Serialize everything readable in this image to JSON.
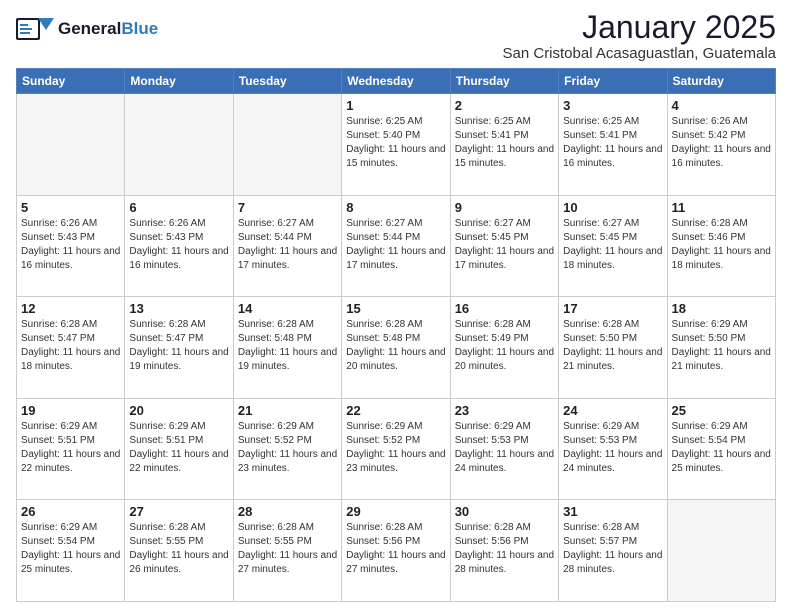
{
  "header": {
    "logo_general": "General",
    "logo_blue": "Blue",
    "month_title": "January 2025",
    "subtitle": "San Cristobal Acasaguastlan, Guatemala"
  },
  "days_of_week": [
    "Sunday",
    "Monday",
    "Tuesday",
    "Wednesday",
    "Thursday",
    "Friday",
    "Saturday"
  ],
  "weeks": [
    [
      {
        "num": "",
        "info": ""
      },
      {
        "num": "",
        "info": ""
      },
      {
        "num": "",
        "info": ""
      },
      {
        "num": "1",
        "info": "Sunrise: 6:25 AM\nSunset: 5:40 PM\nDaylight: 11 hours and 15 minutes."
      },
      {
        "num": "2",
        "info": "Sunrise: 6:25 AM\nSunset: 5:41 PM\nDaylight: 11 hours and 15 minutes."
      },
      {
        "num": "3",
        "info": "Sunrise: 6:25 AM\nSunset: 5:41 PM\nDaylight: 11 hours and 16 minutes."
      },
      {
        "num": "4",
        "info": "Sunrise: 6:26 AM\nSunset: 5:42 PM\nDaylight: 11 hours and 16 minutes."
      }
    ],
    [
      {
        "num": "5",
        "info": "Sunrise: 6:26 AM\nSunset: 5:43 PM\nDaylight: 11 hours and 16 minutes."
      },
      {
        "num": "6",
        "info": "Sunrise: 6:26 AM\nSunset: 5:43 PM\nDaylight: 11 hours and 16 minutes."
      },
      {
        "num": "7",
        "info": "Sunrise: 6:27 AM\nSunset: 5:44 PM\nDaylight: 11 hours and 17 minutes."
      },
      {
        "num": "8",
        "info": "Sunrise: 6:27 AM\nSunset: 5:44 PM\nDaylight: 11 hours and 17 minutes."
      },
      {
        "num": "9",
        "info": "Sunrise: 6:27 AM\nSunset: 5:45 PM\nDaylight: 11 hours and 17 minutes."
      },
      {
        "num": "10",
        "info": "Sunrise: 6:27 AM\nSunset: 5:45 PM\nDaylight: 11 hours and 18 minutes."
      },
      {
        "num": "11",
        "info": "Sunrise: 6:28 AM\nSunset: 5:46 PM\nDaylight: 11 hours and 18 minutes."
      }
    ],
    [
      {
        "num": "12",
        "info": "Sunrise: 6:28 AM\nSunset: 5:47 PM\nDaylight: 11 hours and 18 minutes."
      },
      {
        "num": "13",
        "info": "Sunrise: 6:28 AM\nSunset: 5:47 PM\nDaylight: 11 hours and 19 minutes."
      },
      {
        "num": "14",
        "info": "Sunrise: 6:28 AM\nSunset: 5:48 PM\nDaylight: 11 hours and 19 minutes."
      },
      {
        "num": "15",
        "info": "Sunrise: 6:28 AM\nSunset: 5:48 PM\nDaylight: 11 hours and 20 minutes."
      },
      {
        "num": "16",
        "info": "Sunrise: 6:28 AM\nSunset: 5:49 PM\nDaylight: 11 hours and 20 minutes."
      },
      {
        "num": "17",
        "info": "Sunrise: 6:28 AM\nSunset: 5:50 PM\nDaylight: 11 hours and 21 minutes."
      },
      {
        "num": "18",
        "info": "Sunrise: 6:29 AM\nSunset: 5:50 PM\nDaylight: 11 hours and 21 minutes."
      }
    ],
    [
      {
        "num": "19",
        "info": "Sunrise: 6:29 AM\nSunset: 5:51 PM\nDaylight: 11 hours and 22 minutes."
      },
      {
        "num": "20",
        "info": "Sunrise: 6:29 AM\nSunset: 5:51 PM\nDaylight: 11 hours and 22 minutes."
      },
      {
        "num": "21",
        "info": "Sunrise: 6:29 AM\nSunset: 5:52 PM\nDaylight: 11 hours and 23 minutes."
      },
      {
        "num": "22",
        "info": "Sunrise: 6:29 AM\nSunset: 5:52 PM\nDaylight: 11 hours and 23 minutes."
      },
      {
        "num": "23",
        "info": "Sunrise: 6:29 AM\nSunset: 5:53 PM\nDaylight: 11 hours and 24 minutes."
      },
      {
        "num": "24",
        "info": "Sunrise: 6:29 AM\nSunset: 5:53 PM\nDaylight: 11 hours and 24 minutes."
      },
      {
        "num": "25",
        "info": "Sunrise: 6:29 AM\nSunset: 5:54 PM\nDaylight: 11 hours and 25 minutes."
      }
    ],
    [
      {
        "num": "26",
        "info": "Sunrise: 6:29 AM\nSunset: 5:54 PM\nDaylight: 11 hours and 25 minutes."
      },
      {
        "num": "27",
        "info": "Sunrise: 6:28 AM\nSunset: 5:55 PM\nDaylight: 11 hours and 26 minutes."
      },
      {
        "num": "28",
        "info": "Sunrise: 6:28 AM\nSunset: 5:55 PM\nDaylight: 11 hours and 27 minutes."
      },
      {
        "num": "29",
        "info": "Sunrise: 6:28 AM\nSunset: 5:56 PM\nDaylight: 11 hours and 27 minutes."
      },
      {
        "num": "30",
        "info": "Sunrise: 6:28 AM\nSunset: 5:56 PM\nDaylight: 11 hours and 28 minutes."
      },
      {
        "num": "31",
        "info": "Sunrise: 6:28 AM\nSunset: 5:57 PM\nDaylight: 11 hours and 28 minutes."
      },
      {
        "num": "",
        "info": ""
      }
    ]
  ]
}
